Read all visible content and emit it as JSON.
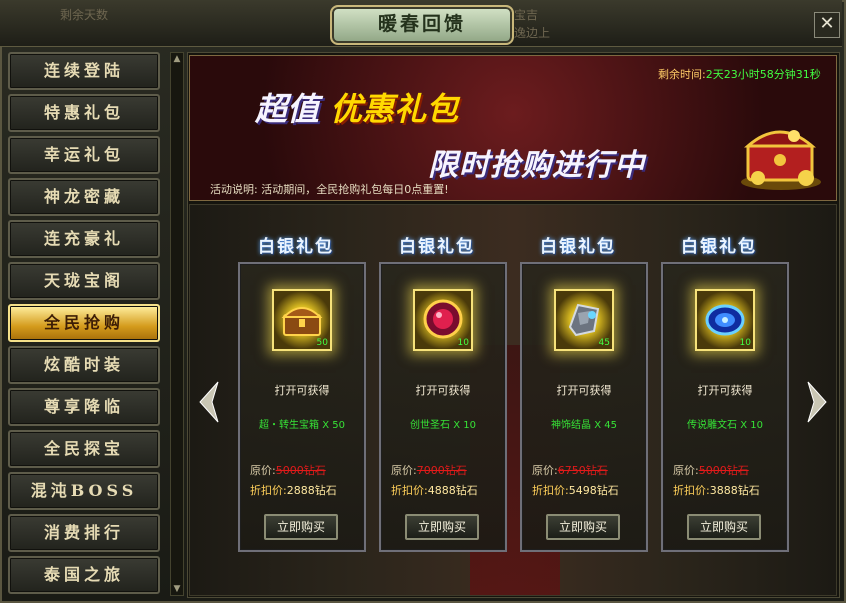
{
  "window": {
    "title": "暖春回馈",
    "ghost_text_left": "剩余天数",
    "ghost_text_right_1": "宝吉",
    "ghost_text_right_2": "逸边上",
    "close_glyph": "✕"
  },
  "sidebar": {
    "items": [
      {
        "label": "连续登陆"
      },
      {
        "label": "特惠礼包"
      },
      {
        "label": "幸运礼包"
      },
      {
        "label": "神龙密藏"
      },
      {
        "label": "连充豪礼"
      },
      {
        "label": "天珑宝阁"
      },
      {
        "label": "全民抢购"
      },
      {
        "label": "炫酷时装"
      },
      {
        "label": "尊享降临"
      },
      {
        "label": "全民探宝"
      },
      {
        "label": "混沌BOSS"
      },
      {
        "label": "消费排行"
      },
      {
        "label": "泰国之旅"
      }
    ],
    "active_index": 6
  },
  "banner": {
    "headline_prefix": "超值",
    "headline_highlight": "优惠礼包",
    "subheadline": "限时抢购进行中",
    "timer_label": "剩余时间:",
    "timer_value": "2天23小时58分钟31秒",
    "description": "活动说明: 活动期间，全民抢购礼包每日0点重置!"
  },
  "products": [
    {
      "title": "白银礼包",
      "icon": "treasure-chest-icon",
      "qty": "50",
      "open_label": "打开可获得",
      "item_label": "超・转生宝箱 X 50",
      "orig_label": "原价:",
      "orig_price": "5000钻石",
      "disc_label": "折扣价:",
      "disc_price": "2888钻石",
      "buy_label": "立即购买"
    },
    {
      "title": "白银礼包",
      "icon": "ruby-gem-icon",
      "qty": "10",
      "open_label": "打开可获得",
      "item_label": "创世圣石 X 10",
      "orig_label": "原价:",
      "orig_price": "7000钻石",
      "disc_label": "折扣价:",
      "disc_price": "4888钻石",
      "buy_label": "立即购买"
    },
    {
      "title": "白银礼包",
      "icon": "crystal-shard-icon",
      "qty": "45",
      "open_label": "打开可获得",
      "item_label": "神饰结晶 X 45",
      "orig_label": "原价:",
      "orig_price": "6750钻石",
      "disc_label": "折扣价:",
      "disc_price": "5498钻石",
      "buy_label": "立即购买"
    },
    {
      "title": "白银礼包",
      "icon": "rune-stone-icon",
      "qty": "10",
      "open_label": "打开可获得",
      "item_label": "传说雕文石 X 10",
      "orig_label": "原价:",
      "orig_price": "5000钻石",
      "disc_label": "折扣价:",
      "disc_price": "3888钻石",
      "buy_label": "立即购买"
    }
  ],
  "colors": {
    "active_tab": "#d49b1c",
    "timer_green": "#42ff42",
    "item_green": "#36e236",
    "original_price_red": "#e11a1a",
    "discount_gold": "#ffd05a"
  }
}
